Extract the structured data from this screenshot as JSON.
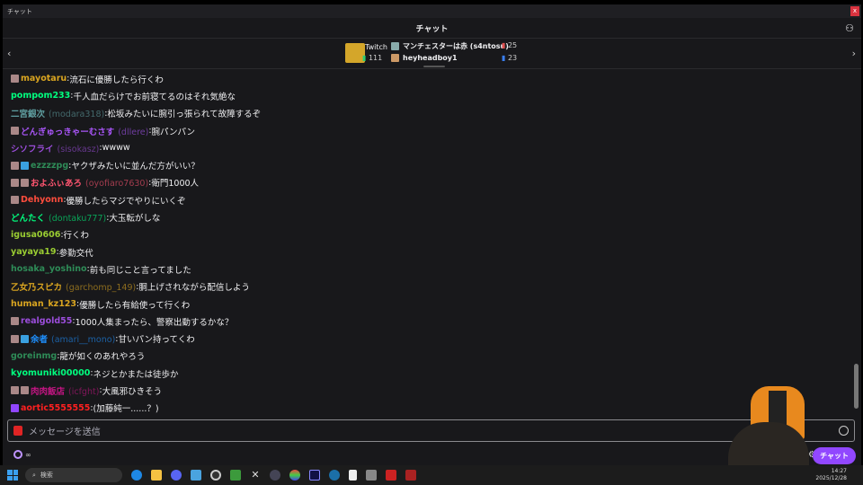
{
  "window": {
    "title": "チャット",
    "close": "x"
  },
  "header": {
    "title": "チャット",
    "user_icon": "users-icon"
  },
  "gifts": {
    "leader_label": "Twitch",
    "leader_count": "111",
    "top": [
      {
        "name": "マンチェスターは赤 (s4ntosu)",
        "count": "25",
        "color": "#e05050"
      },
      {
        "name": "heyheadboy1",
        "count": "23",
        "color": "#3a7ef0"
      }
    ]
  },
  "chat": [
    {
      "badges": [
        "user"
      ],
      "name": "mayotaru",
      "color": "#daa520",
      "msg": "流石に優勝したら行くわ"
    },
    {
      "badges": [],
      "name": "pompom233",
      "color": "#00ff7f",
      "msg": "千人血だらけでお前寝てるのはそれ気絶な"
    },
    {
      "badges": [],
      "name": "二宮銀次",
      "login": "(modara318)",
      "color": "#5f9ea0",
      "msg": "松坂みたいに腕引っ張られて故障するぞ"
    },
    {
      "badges": [
        "user"
      ],
      "name": "どんぎゅっきゃーむさす",
      "login": "(dllere)",
      "color": "#a855f7",
      "msg": "腕パンパン"
    },
    {
      "badges": [],
      "name": "シソフライ",
      "login": "(sisokasz)",
      "color": "#9b4ddb",
      "msg": "wwww"
    },
    {
      "badges": [
        "user",
        "sub"
      ],
      "name": "ezzzzpg",
      "color": "#2e8b57",
      "msg": "ヤクザみたいに並んだ方がいい？"
    },
    {
      "badges": [
        "user",
        "user"
      ],
      "name": "およふぃあろ",
      "login": "(oyofiaro7630)",
      "color": "#ff5570",
      "msg": "衛門1000人"
    },
    {
      "badges": [
        "user"
      ],
      "name": "Dehyonn",
      "color": "#ff4d3d",
      "msg": "優勝したらマジでやりにいくぞ"
    },
    {
      "badges": [],
      "name": "どんたく",
      "login": "(dontaku777)",
      "color": "#00ff7f",
      "msg": "大玉転がしな"
    },
    {
      "badges": [],
      "name": "igusa0606",
      "color": "#9acd32",
      "msg": "行くわ"
    },
    {
      "badges": [],
      "name": "yayaya19",
      "color": "#9acd32",
      "msg": "参勤交代"
    },
    {
      "badges": [],
      "name": "hosaka_yoshino",
      "color": "#2e8b57",
      "msg": "前も同じこと言ってました"
    },
    {
      "badges": [],
      "name": "乙女乃スピカ",
      "login": "(garchomp_149)",
      "color": "#daa520",
      "msg": "胴上げされながら配信しよう"
    },
    {
      "badges": [],
      "name": "human_kz123",
      "color": "#daa520",
      "msg": "優勝したら有給使って行くわ"
    },
    {
      "badges": [
        "user"
      ],
      "name": "realgold55",
      "color": "#9b4ddb",
      "msg": "1000人集まったら、警察出動するかな？"
    },
    {
      "badges": [
        "user",
        "sub"
      ],
      "name": "余者",
      "login": "(amari__mono)",
      "color": "#1e90ff",
      "msg": "甘いパン持ってくわ"
    },
    {
      "badges": [],
      "name": "goreinmg",
      "color": "#2e8b57",
      "msg": "龍が如くのあれやろう"
    },
    {
      "badges": [],
      "name": "kyomuniki00000",
      "color": "#00ff7f",
      "msg": "ネジとかまたは徒歩か"
    },
    {
      "badges": [
        "user",
        "user"
      ],
      "name": "肉肉飯店",
      "login": "(icfght)",
      "color": "#c71585",
      "msg": "大風邪ひきそう"
    },
    {
      "badges": [
        "vid"
      ],
      "name": "aortic5555555",
      "color": "#ff2020",
      "msg": "(加藤純一......？)"
    }
  ],
  "input": {
    "placeholder": "メッセージを送信"
  },
  "bottom": {
    "points": "∞",
    "chat_button": "チャット"
  },
  "taskbar": {
    "search": "検索",
    "time": "14:27",
    "date": "2025/12/28"
  },
  "colors": {
    "accent": "#9147ff",
    "background": "#18181b"
  }
}
